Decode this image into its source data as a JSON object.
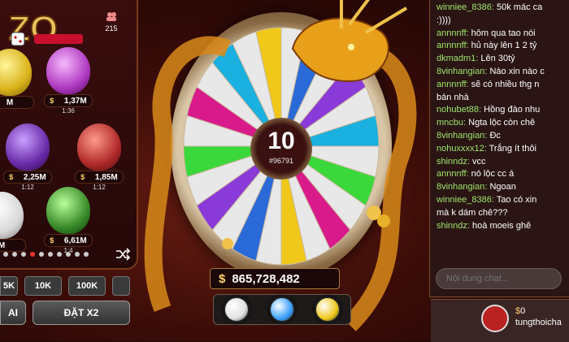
{
  "left_panel": {
    "online_count": "215",
    "eggs": [
      {
        "value": "M",
        "timer": "",
        "color": "#d9b21a"
      },
      {
        "value": "1,37M",
        "timer": "1:36",
        "color": "#b03ac0"
      },
      {
        "value": "2,25M",
        "timer": "1:12",
        "color": "#6a2aa8"
      },
      {
        "value": "1,85M",
        "timer": "1:12",
        "color": "#b02a2a"
      },
      {
        "value": "M",
        "timer": "",
        "color": "#e8e8e8"
      },
      {
        "value": "6,61M",
        "timer": "1:4",
        "color": "#3a8a2a"
      }
    ],
    "currency_symbol": "$",
    "bet_buttons": [
      "5K",
      "10K",
      "100K"
    ],
    "action_buttons": [
      "AI",
      "ĐẶT X2"
    ]
  },
  "wheel": {
    "result_number": "10",
    "round_id": "#96791",
    "segment_colors": [
      "#e8e8e8",
      "#2a6ad8",
      "#e8e8e8",
      "#8a3ad8",
      "#e8e8e8",
      "#1ab0e0",
      "#e8e8e8",
      "#3ad83a",
      "#e8e8e8",
      "#d81a8a",
      "#e8e8e8",
      "#f0c81a",
      "#e8e8e8",
      "#2a6ad8",
      "#e8e8e8",
      "#8a3ad8",
      "#e8e8e8",
      "#3ad83a",
      "#e8e8e8",
      "#d81a8a",
      "#e8e8e8",
      "#1ab0e0",
      "#e8e8e8",
      "#f0c81a"
    ]
  },
  "pot": {
    "currency_symbol": "$",
    "amount": "865,728,482"
  },
  "color_options": [
    "#e0e0e0",
    "#3aa0ff",
    "#f0c81a"
  ],
  "chat": {
    "messages": [
      {
        "user": "winniee_8386:",
        "text": "50k mác ca"
      },
      {
        "user": "",
        "text": ":))))"
      },
      {
        "user": "annnnff:",
        "text": "hôm qua tao nói"
      },
      {
        "user": "annnnff:",
        "text": "hủ này lên 1 2 tỷ"
      },
      {
        "user": "dkmadm1:",
        "text": "Lên 30tỷ"
      },
      {
        "user": "8vinhangian:",
        "text": "Nào xin nào c"
      },
      {
        "user": "annnnff:",
        "text": "sẽ có nhiều thg n"
      },
      {
        "user": "",
        "text": "bán nhà"
      },
      {
        "user": "nohubet88:",
        "text": "Hồng đào nhu"
      },
      {
        "user": "mncbu:",
        "text": "Ngta lộc còn chê"
      },
      {
        "user": "8vinhangian:",
        "text": "Đc"
      },
      {
        "user": "nohuxxxx12:",
        "text": "Trắng ít thôi"
      },
      {
        "user": "shinndz:",
        "text": "vcc"
      },
      {
        "user": "annnnff:",
        "text": "nó lộc cc á"
      },
      {
        "user": "8vinhangian:",
        "text": "Ngoan"
      },
      {
        "user": "winniee_8386:",
        "text": "Tao có xin"
      },
      {
        "user": "",
        "text": "mà k dám chê???"
      },
      {
        "user": "shinndz:",
        "text": "hoà moeis ghê"
      }
    ],
    "input_placeholder": "Nội dung chat..."
  },
  "profile": {
    "currency_symbol": "$",
    "balance": "0",
    "username": "tungthoicha"
  }
}
